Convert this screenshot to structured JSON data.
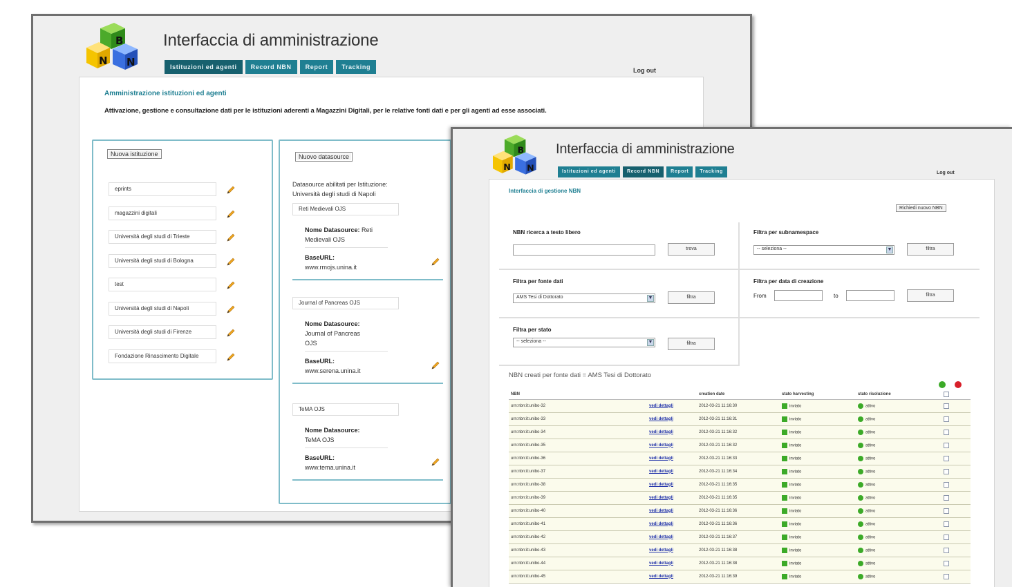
{
  "app": {
    "title": "Interfaccia di amministrazione",
    "logout": "Log out",
    "tabs": [
      "Istituzioni ed agenti",
      "Record NBN",
      "Report",
      "Tracking"
    ],
    "logo_letters": [
      "B",
      "N",
      "N"
    ]
  },
  "colors": {
    "accent": "#1f7f92",
    "box_border": "#7fbcc9",
    "ok_green": "#3caa28",
    "row_bg": "#fbfbec"
  },
  "institutions_page": {
    "section_title": "Amministrazione istituzioni ed agenti",
    "description": "Attivazione, gestione e consultazione dati per le istituzioni aderenti a Magazzini Digitali, per le relative fonti dati e per gli agenti ad esse associati.",
    "new_institution_button": "Nuova istituzione",
    "institutions": [
      "eprints",
      "magazzini digitali",
      "Università degli studi di Trieste",
      "Università degli studi di Bologna",
      "test",
      "Università degli studi di Napoli",
      "Università degli studi di Firenze",
      "Fondazione Rinascimento Digitale"
    ],
    "new_datasource_button": "Nuovo datasource",
    "datasources_heading_1": "Datasource abilitati per Istituzione:",
    "datasources_heading_2": "Università degli studi di Napoli",
    "name_label": "Nome Datasource:",
    "baseurl_label": "BaseURL:",
    "datasources": [
      {
        "field": "Reti Medievali OJS",
        "name_suffix": "Reti",
        "name_cont": [
          "Medievali OJS"
        ],
        "url": "www.rmojs.unina.it"
      },
      {
        "field": "Journal of Pancreas OJS",
        "name_suffix": "",
        "name_cont": [
          "Journal of Pancreas",
          "OJS"
        ],
        "url": "www.serena.unina.it"
      },
      {
        "field": "TeMA OJS",
        "name_suffix": "",
        "name_cont": [
          "TeMA OJS"
        ],
        "url": "www.tema.unina.it"
      }
    ]
  },
  "nbn_page": {
    "section_title": "Interfaccia di gestione NBN",
    "request_button": "Richiedi nuovo NBN",
    "filters": {
      "free_text_label": "NBN ricerca a testo libero",
      "free_text_value": "",
      "search_button": "trova",
      "subnamespace_label": "Filtra per subnamespace",
      "subnamespace_value": "-- seleziona --",
      "source_label": "Filtra per fonte dati",
      "source_value": "AMS Tesi di Dottorato",
      "date_label": "Filtra per data di creazione",
      "date_from_label": "From",
      "date_to_label": "to",
      "status_label": "Filtra per stato",
      "status_value": "-- seleziona --",
      "filter_button": "filtra"
    },
    "results_caption": "NBN creati per fonte dati = AMS Tesi di Dottorato",
    "table": {
      "columns": [
        "NBN",
        "",
        "creation date",
        "stato harvesting",
        "stato risoluzione",
        ""
      ],
      "link_label": "vedi dettagli",
      "harvest_label": "inviato",
      "resolution_label": "attivo",
      "rows": [
        {
          "nbn": "urn:nbn:it:unibo-32",
          "date": "2012-03-21 11:16:30"
        },
        {
          "nbn": "urn:nbn:it:unibo-33",
          "date": "2012-03-21 11:16:31"
        },
        {
          "nbn": "urn:nbn:it:unibo-34",
          "date": "2012-03-21 11:16:32"
        },
        {
          "nbn": "urn:nbn:it:unibo-35",
          "date": "2012-03-21 11:16:32"
        },
        {
          "nbn": "urn:nbn:it:unibo-36",
          "date": "2012-03-21 11:16:33"
        },
        {
          "nbn": "urn:nbn:it:unibo-37",
          "date": "2012-03-21 11:16:34"
        },
        {
          "nbn": "urn:nbn:it:unibo-38",
          "date": "2012-03-21 11:16:35"
        },
        {
          "nbn": "urn:nbn:it:unibo-39",
          "date": "2012-03-21 11:16:35"
        },
        {
          "nbn": "urn:nbn:it:unibo-40",
          "date": "2012-03-21 11:16:36"
        },
        {
          "nbn": "urn:nbn:it:unibo-41",
          "date": "2012-03-21 11:16:36"
        },
        {
          "nbn": "urn:nbn:it:unibo-42",
          "date": "2012-03-21 11:16:37"
        },
        {
          "nbn": "urn:nbn:it:unibo-43",
          "date": "2012-03-21 11:16:38"
        },
        {
          "nbn": "urn:nbn:it:unibo-44",
          "date": "2012-03-21 11:16:38"
        },
        {
          "nbn": "urn:nbn:it:unibo-45",
          "date": "2012-03-21 11:16:39"
        }
      ]
    }
  }
}
